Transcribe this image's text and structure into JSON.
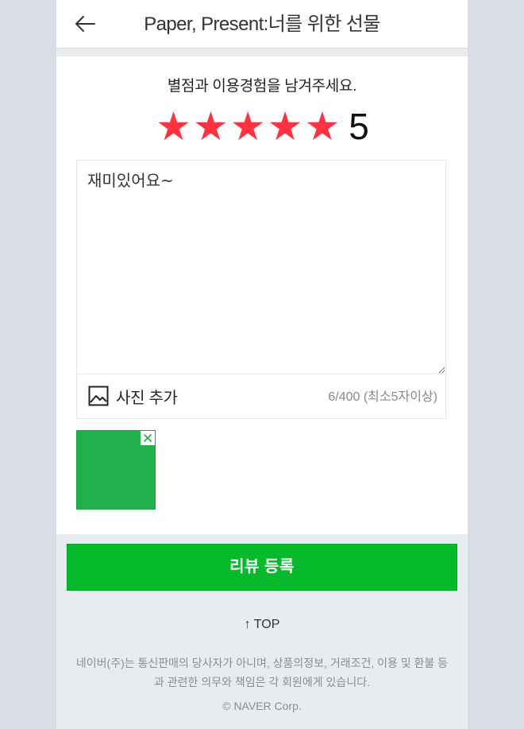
{
  "header": {
    "title": "Paper, Present:너를 위한 선물",
    "back_icon": "arrow-left-icon"
  },
  "review": {
    "prompt": "별점과 이용경험을 남겨주세요.",
    "stars": [
      "★",
      "★",
      "★",
      "★",
      "★"
    ],
    "rating": 5,
    "rating_label": "5",
    "star_color": "#ff3340",
    "text": "재미있어요~",
    "photo_add_label": "사진 추가",
    "photo_icon": "image-icon",
    "char_count": "6/400 (최소5자이상)",
    "attached_photo_color": "#22b24c",
    "remove_icon": "close-icon"
  },
  "actions": {
    "submit_label": "리뷰 등록",
    "submit_color": "#07ba2c"
  },
  "footer": {
    "top_label": "↑ TOP",
    "notice": "네이버(주)는 통신판매의 당사자가 아니며, 상품의정보, 거래조건, 이용 및 환불 등과 관련한 의무와 책임은 각 회원에게 있습니다.",
    "copyright": "© NAVER Corp."
  }
}
